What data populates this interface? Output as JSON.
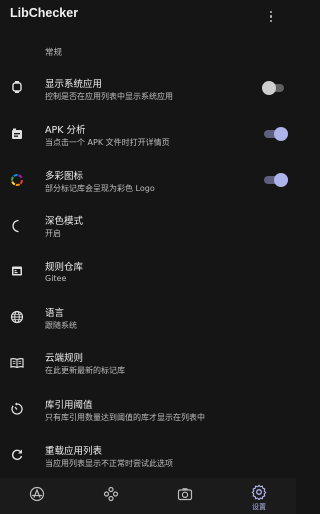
{
  "app": {
    "title": "LibChecker"
  },
  "section": {
    "title": "常规"
  },
  "settings": [
    {
      "title": "显示系统应用",
      "subtitle": "控制是否在应用列表中显示系统应用",
      "icon": "android-icon",
      "switch": "off"
    },
    {
      "title": "APK 分析",
      "subtitle": "当点击一个 APK 文件时打开详情页",
      "icon": "apk-file-icon",
      "switch": "on"
    },
    {
      "title": "多彩图标",
      "subtitle": "部分标记库会呈现为彩色 Logo",
      "icon": "colorful-ring-icon",
      "switch": "on"
    },
    {
      "title": "深色模式",
      "subtitle": "开启",
      "icon": "moon-icon",
      "switch": null
    },
    {
      "title": "规则仓库",
      "subtitle": "Gitee",
      "icon": "repository-icon",
      "switch": null
    },
    {
      "title": "语言",
      "subtitle": "跟随系统",
      "icon": "globe-icon",
      "switch": null
    },
    {
      "title": "云端规则",
      "subtitle": "在此更新最新的标记库",
      "icon": "book-icon",
      "switch": null
    },
    {
      "title": "库引用阈值",
      "subtitle": "只有库引用数量达到阈值的库才显示在列表中",
      "icon": "threshold-icon",
      "switch": null
    },
    {
      "title": "重载应用列表",
      "subtitle": "当应用列表显示不正常时尝试此选项",
      "icon": "reload-icon",
      "switch": null
    }
  ],
  "bottom_nav": {
    "items": [
      {
        "icon": "apps-icon",
        "label": ""
      },
      {
        "icon": "statistics-icon",
        "label": ""
      },
      {
        "icon": "snapshot-icon",
        "label": ""
      },
      {
        "icon": "settings-gear-icon",
        "label": "设置"
      }
    ],
    "active_index": 3
  },
  "colors": {
    "background": "#151515",
    "accent": "#aeb3ea",
    "switch_off_track": "#616161",
    "switch_on_track": "#5d5f7d"
  }
}
